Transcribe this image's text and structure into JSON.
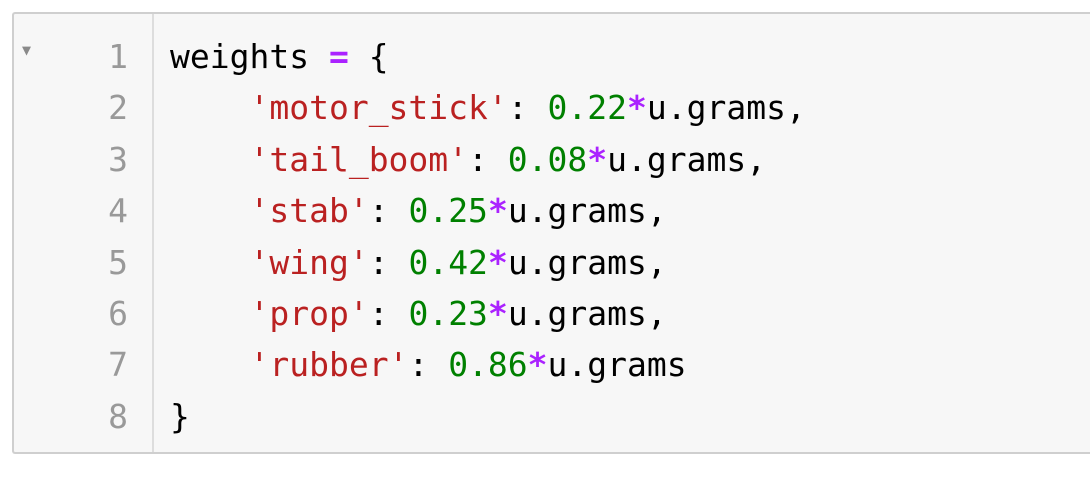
{
  "editor": {
    "fold_icon": "triangle-down-icon",
    "lines": [
      {
        "no": "1",
        "tokens": [
          {
            "t": "plain",
            "v": "weights "
          },
          {
            "t": "op",
            "v": "="
          },
          {
            "t": "plain",
            "v": " {"
          }
        ]
      },
      {
        "no": "2",
        "tokens": [
          {
            "t": "plain",
            "v": "    "
          },
          {
            "t": "str",
            "v": "'motor_stick'"
          },
          {
            "t": "plain",
            "v": ": "
          },
          {
            "t": "num",
            "v": "0.22"
          },
          {
            "t": "op",
            "v": "*"
          },
          {
            "t": "plain",
            "v": "u.grams,"
          }
        ]
      },
      {
        "no": "3",
        "tokens": [
          {
            "t": "plain",
            "v": "    "
          },
          {
            "t": "str",
            "v": "'tail_boom'"
          },
          {
            "t": "plain",
            "v": ": "
          },
          {
            "t": "num",
            "v": "0.08"
          },
          {
            "t": "op",
            "v": "*"
          },
          {
            "t": "plain",
            "v": "u.grams,"
          }
        ]
      },
      {
        "no": "4",
        "tokens": [
          {
            "t": "plain",
            "v": "    "
          },
          {
            "t": "str",
            "v": "'stab'"
          },
          {
            "t": "plain",
            "v": ": "
          },
          {
            "t": "num",
            "v": "0.25"
          },
          {
            "t": "op",
            "v": "*"
          },
          {
            "t": "plain",
            "v": "u.grams,"
          }
        ]
      },
      {
        "no": "5",
        "tokens": [
          {
            "t": "plain",
            "v": "    "
          },
          {
            "t": "str",
            "v": "'wing'"
          },
          {
            "t": "plain",
            "v": ": "
          },
          {
            "t": "num",
            "v": "0.42"
          },
          {
            "t": "op",
            "v": "*"
          },
          {
            "t": "plain",
            "v": "u.grams,"
          }
        ]
      },
      {
        "no": "6",
        "tokens": [
          {
            "t": "plain",
            "v": "    "
          },
          {
            "t": "str",
            "v": "'prop'"
          },
          {
            "t": "plain",
            "v": ": "
          },
          {
            "t": "num",
            "v": "0.23"
          },
          {
            "t": "op",
            "v": "*"
          },
          {
            "t": "plain",
            "v": "u.grams,"
          }
        ]
      },
      {
        "no": "7",
        "tokens": [
          {
            "t": "plain",
            "v": "    "
          },
          {
            "t": "str",
            "v": "'rubber'"
          },
          {
            "t": "plain",
            "v": ": "
          },
          {
            "t": "num",
            "v": "0.86"
          },
          {
            "t": "op",
            "v": "*"
          },
          {
            "t": "plain",
            "v": "u.grams"
          }
        ]
      },
      {
        "no": "8",
        "tokens": [
          {
            "t": "plain",
            "v": "}"
          }
        ]
      }
    ]
  }
}
